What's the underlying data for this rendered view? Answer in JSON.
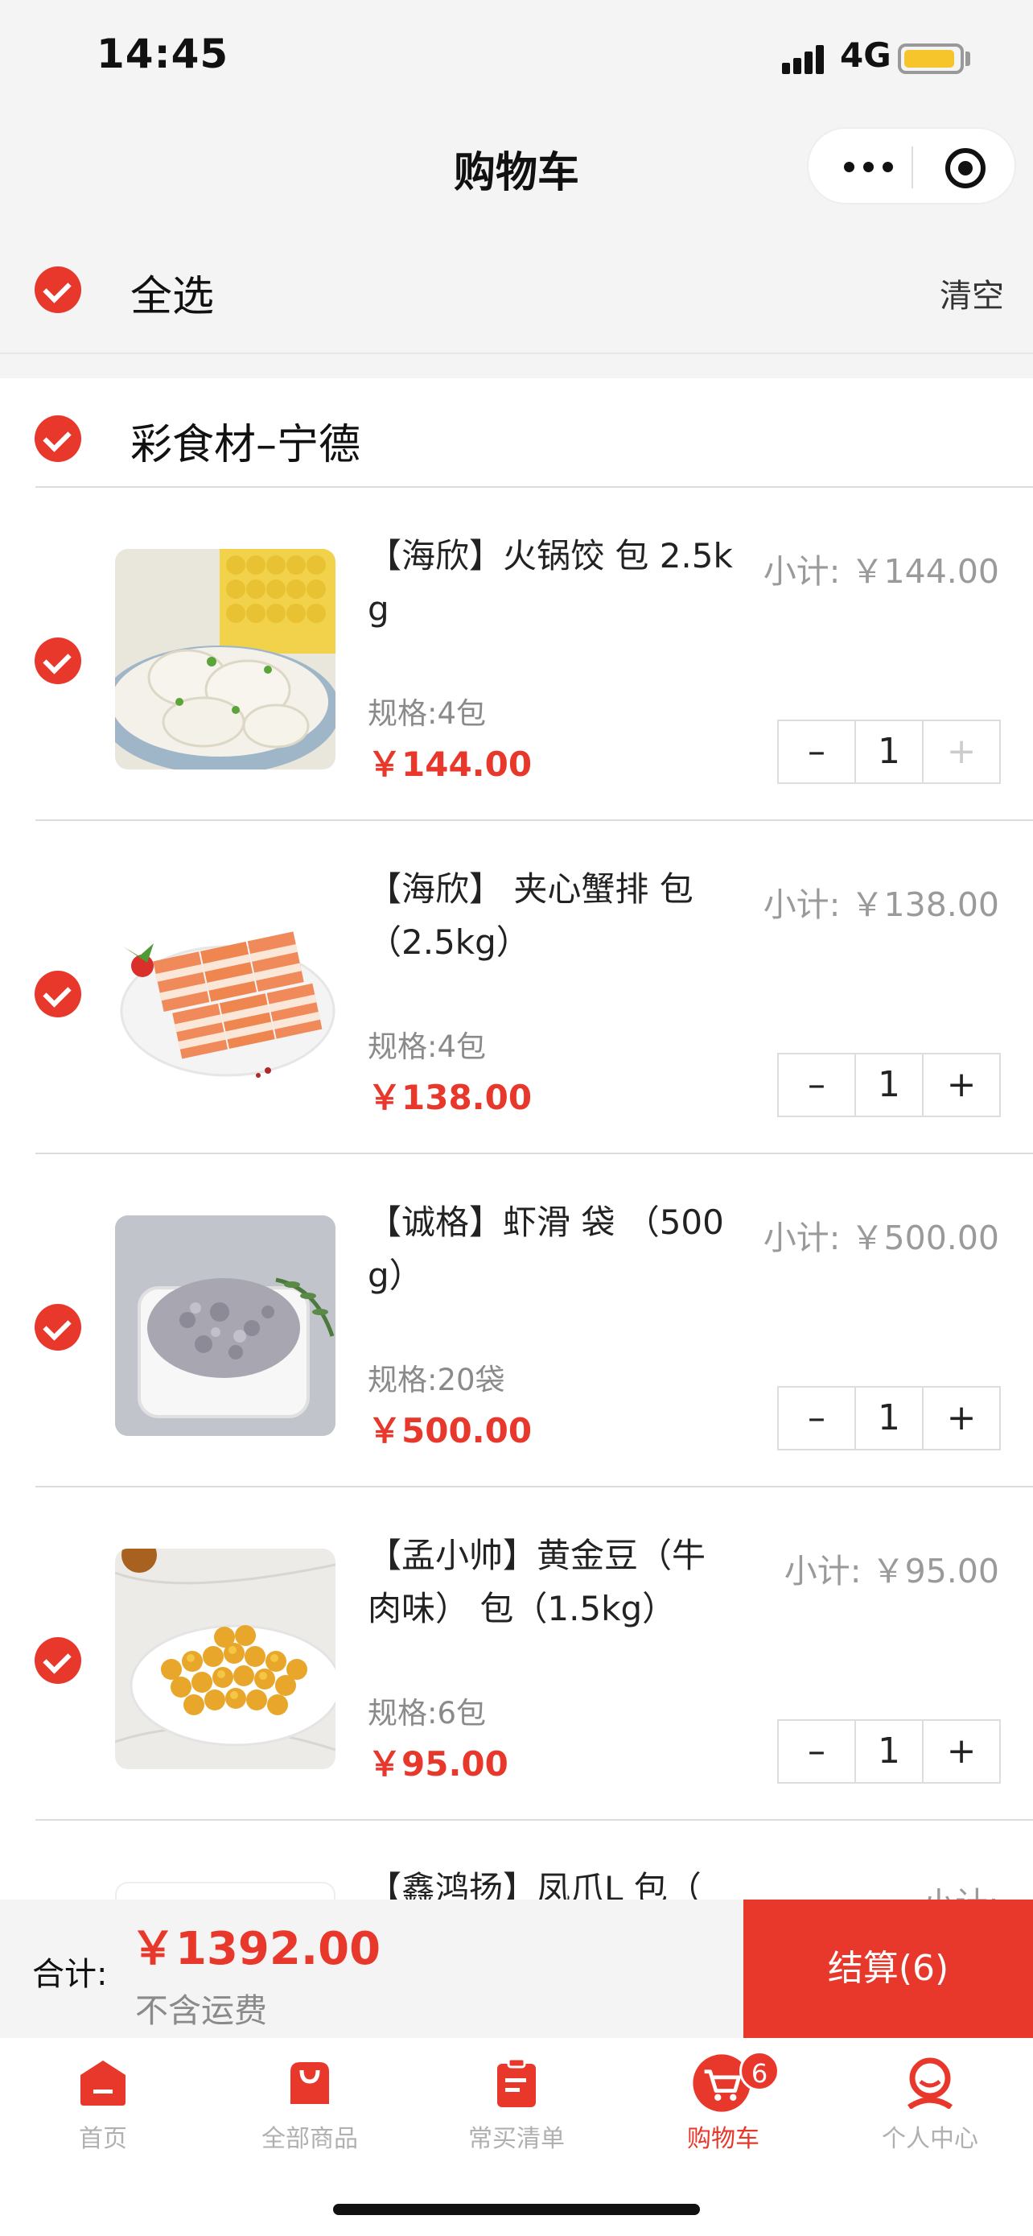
{
  "status_bar": {
    "time": "14:45",
    "network": "4G"
  },
  "nav": {
    "title": "购物车"
  },
  "select_all": {
    "label": "全选",
    "clear": "清空"
  },
  "store": {
    "name": "彩食材–宁德"
  },
  "items": [
    {
      "name": "【海欣】火锅饺 包 2.5kg",
      "spec": "规格:4包",
      "price": "￥144.00",
      "subtotal": "小计:  ￥144.00",
      "qty": "1",
      "minus": "–",
      "plus": "+"
    },
    {
      "name": "【海欣】 夹心蟹排 包（2.5kg）",
      "spec": "规格:4包",
      "price": "￥138.00",
      "subtotal": "小计:  ￥138.00",
      "qty": "1",
      "minus": "–",
      "plus": "+"
    },
    {
      "name": "【诚格】虾滑 袋 （500g）",
      "spec": "规格:20袋",
      "price": "￥500.00",
      "subtotal": "小计:  ￥500.00",
      "qty": "1",
      "minus": "–",
      "plus": "+"
    },
    {
      "name": "【孟小帅】黄金豆（牛肉味） 包（1.5kg）",
      "spec": "规格:6包",
      "price": "￥95.00",
      "subtotal": "小计:  ￥95.00",
      "qty": "1",
      "minus": "–",
      "plus": "+"
    },
    {
      "name": "【鑫鸿扬】凤爪L 包（",
      "subtotal": "小计:"
    }
  ],
  "checkout": {
    "total_label": "合计:",
    "total_amount": "￥1392.00",
    "shipping_note": "不含运费",
    "button": "结算(6)"
  },
  "tabs": [
    {
      "label": "首页",
      "icon": "home-icon"
    },
    {
      "label": "全部商品",
      "icon": "shopping-bag-icon"
    },
    {
      "label": "常买清单",
      "icon": "clipboard-icon"
    },
    {
      "label": "购物车",
      "icon": "cart-icon",
      "badge": "6",
      "active": true
    },
    {
      "label": "个人中心",
      "icon": "user-icon"
    }
  ],
  "colors": {
    "accent": "#e8372b",
    "muted": "#b0b0b0"
  }
}
